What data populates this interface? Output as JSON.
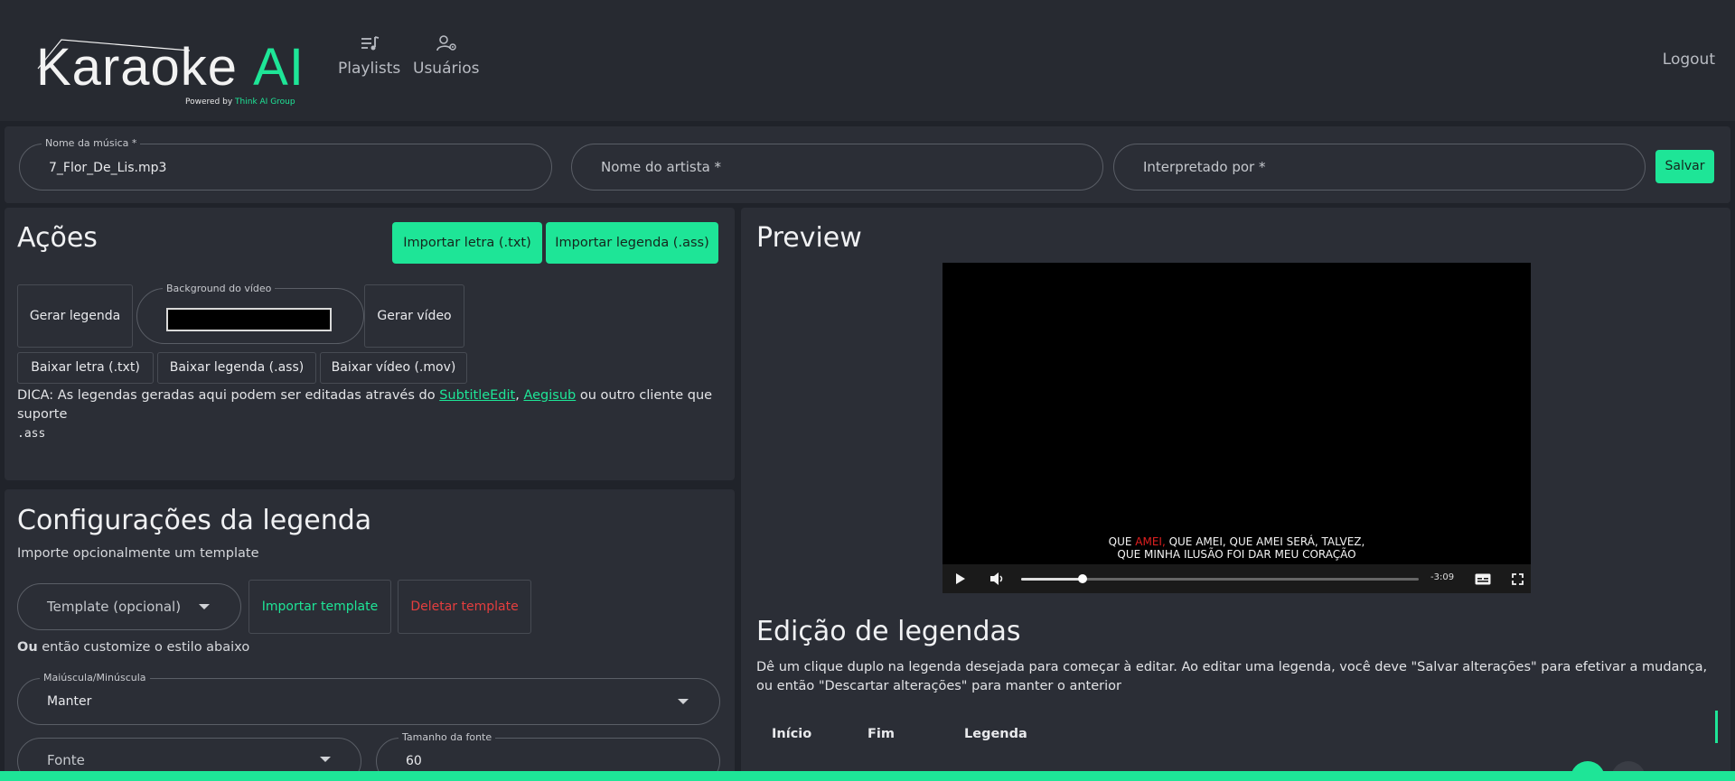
{
  "header": {
    "logo_main": "Karaoke",
    "logo_accent": "AI",
    "logo_powered_prefix": "Powered by",
    "logo_powered_brand": "Think AI Group",
    "nav": [
      {
        "label": "Playlists",
        "icon": "playlist-music-icon"
      },
      {
        "label": "Usuários",
        "icon": "user-settings-icon"
      }
    ],
    "logout": "Logout"
  },
  "song": {
    "name_label": "Nome da música *",
    "name_value": "7_Flor_De_Lis.mp3",
    "artist_placeholder": "Nome do artista *",
    "performer_placeholder": "Interpretado por *",
    "save": "Salvar"
  },
  "actions": {
    "title": "Ações",
    "import_lyrics": "Importar letra (.txt)",
    "import_subtitle": "Importar legenda (.ass)",
    "generate_subtitle": "Gerar legenda",
    "bg_label": "Background do vídeo",
    "bg_color": "#000000",
    "generate_video": "Gerar vídeo",
    "download_lyrics": "Baixar letra (.txt)",
    "download_subtitle": "Baixar legenda (.ass)",
    "download_video": "Baixar vídeo (.mov)",
    "tip_prefix": "DICA: As legendas geradas aqui podem ser editadas através do ",
    "tip_link1": "SubtitleEdit",
    "tip_sep": ", ",
    "tip_link2": "Aegisub",
    "tip_suffix": " ou outro cliente que suporte ",
    "tip_ext": ".ass"
  },
  "config": {
    "title": "Configurações da legenda",
    "import_hint": "Importe opcionalmente um template",
    "template_placeholder": "Template (opcional)",
    "import_template": "Importar template",
    "delete_template": "Deletar template",
    "or_bold": "Ou",
    "or_rest": " então customize o estilo abaixo",
    "case_label": "Maiúscula/Minúscula",
    "case_value": "Manter",
    "font_placeholder": "Fonte",
    "size_label": "Tamanho da fonte",
    "size_value": "60"
  },
  "preview": {
    "title": "Preview",
    "sub_line1_pre": "QUE ",
    "sub_line1_hl": "AMEI,",
    "sub_line1_post": " QUE AMEI, QUE AMEI SERÁ, TALVEZ,",
    "sub_line2": "QUE MINHA ILUSÃO FOI DAR MEU CORAÇÃO",
    "time_remaining": "-3:09",
    "progress": 0.155
  },
  "editing": {
    "title": "Edição de legendas",
    "description": "Dê um clique duplo na legenda desejada para começar à editar. Ao editar uma legenda, você deve \"Salvar alterações\" para efetivar a mudança, ou então \"Descartar alterações\" para manter o anterior",
    "columns": [
      "Início",
      "Fim",
      "Legenda"
    ]
  },
  "colors": {
    "accent": "#1ee597",
    "danger": "#e53e3e",
    "background": "#20232a",
    "panel": "#2b2e36"
  }
}
